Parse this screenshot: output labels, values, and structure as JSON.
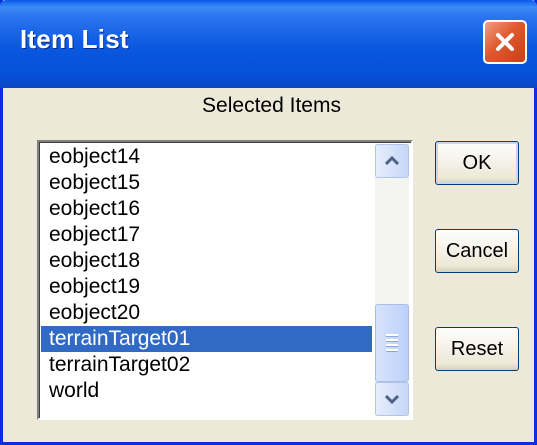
{
  "window": {
    "title": "Item List"
  },
  "caption": "Selected Items",
  "list": {
    "items": [
      {
        "label": "eobject14",
        "selected": false
      },
      {
        "label": "eobject15",
        "selected": false
      },
      {
        "label": "eobject16",
        "selected": false
      },
      {
        "label": "eobject17",
        "selected": false
      },
      {
        "label": "eobject18",
        "selected": false
      },
      {
        "label": "eobject19",
        "selected": false
      },
      {
        "label": "eobject20",
        "selected": false
      },
      {
        "label": "terrainTarget01",
        "selected": true
      },
      {
        "label": "terrainTarget02",
        "selected": false
      },
      {
        "label": "world",
        "selected": false
      }
    ]
  },
  "buttons": {
    "ok": "OK",
    "cancel": "Cancel",
    "reset": "Reset"
  },
  "colors": {
    "selection": "#316ac5",
    "titlebar": "#0a58e0",
    "close": "#e0582e",
    "face": "#ece9d8"
  },
  "icons": {
    "close": "close-icon",
    "up": "chevron-up-icon",
    "down": "chevron-down-icon",
    "grip": "grip-icon"
  }
}
